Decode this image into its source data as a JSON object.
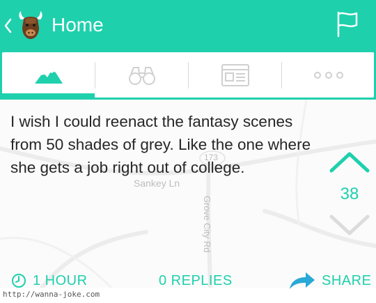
{
  "header": {
    "title": "Home",
    "back_icon": "chevron-left-icon",
    "logo_icon": "yak-mascot-icon",
    "flag_icon": "flag-icon"
  },
  "tabs": [
    {
      "icon": "mountains-icon",
      "active": true
    },
    {
      "icon": "binoculars-icon",
      "active": false
    },
    {
      "icon": "newspaper-icon",
      "active": false
    },
    {
      "icon": "more-dots-icon",
      "active": false
    }
  ],
  "post": {
    "text": "I wish I could reenact the fantasy scenes from 50 shades of grey. Like the one where she gets a job right out of college.",
    "votes": "38"
  },
  "map": {
    "street1": "Sankey Ln",
    "street2": "Grove City Rd",
    "route": "173"
  },
  "footer": {
    "time": "1 HOUR",
    "replies": "0 REPLIES",
    "share": "SHARE"
  },
  "watermark": "http://wanna-joke.com",
  "colors": {
    "accent": "#1fd0ad",
    "text": "#262626",
    "divider": "#d9d9d9"
  }
}
